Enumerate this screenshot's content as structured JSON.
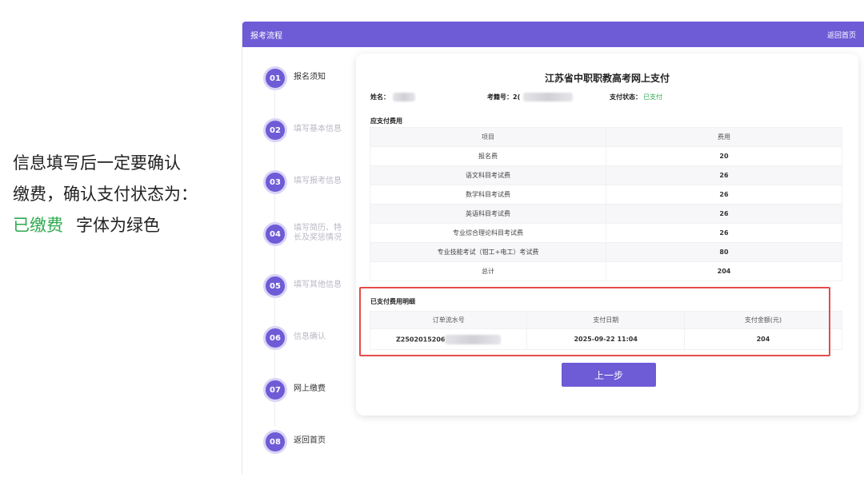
{
  "note": {
    "line1": "信息填写后一定要确认",
    "line2": "缴费，确认支付状态为：",
    "green_text": "已缴费",
    "suffix": "字体为绿色"
  },
  "header": {
    "title": "报考流程",
    "back_label": "返回首页"
  },
  "steps": [
    {
      "num": "01",
      "label": "报名须知",
      "dim": false
    },
    {
      "num": "02",
      "label": "填写基本信息",
      "dim": true
    },
    {
      "num": "03",
      "label": "填写报考信息",
      "dim": true
    },
    {
      "num": "04",
      "label": "填写简历、特长及奖惩情况",
      "dim": true
    },
    {
      "num": "05",
      "label": "填写其他信息",
      "dim": true
    },
    {
      "num": "06",
      "label": "信息确认",
      "dim": true
    },
    {
      "num": "07",
      "label": "网上缴费",
      "dim": false
    },
    {
      "num": "08",
      "label": "返回首页",
      "dim": false
    }
  ],
  "card": {
    "title": "江苏省中职职教高考网上支付",
    "name_label": "姓名：",
    "exam_no_label": "考籍号：",
    "exam_no_prefix": "2(",
    "status_label": "支付状态：",
    "status_value": "已支付",
    "fee_section_title": "应支付费用",
    "fee_headers": [
      "项目",
      "费用"
    ],
    "fee_rows": [
      {
        "item": "报名费",
        "fee": "20"
      },
      {
        "item": "语文科目考试费",
        "fee": "26"
      },
      {
        "item": "数学科目考试费",
        "fee": "26"
      },
      {
        "item": "英语科目考试费",
        "fee": "26"
      },
      {
        "item": "专业综合理论科目考试费",
        "fee": "26"
      },
      {
        "item": "专业技能考试（钳工+电工）考试费",
        "fee": "80"
      },
      {
        "item": "总计",
        "fee": "204"
      }
    ],
    "paid_section_title": "已支付费用明细",
    "paid_headers": [
      "订单流水号",
      "支付日期",
      "支付金额(元)"
    ],
    "paid_row": {
      "order": "Z2502015206",
      "date": "2025-09-22 11:04",
      "amount": "204"
    },
    "prev_button": "上一步"
  },
  "colors": {
    "accent": "#6e5bd6",
    "success": "#2eaa4f",
    "highlight": "#e44c4c"
  }
}
